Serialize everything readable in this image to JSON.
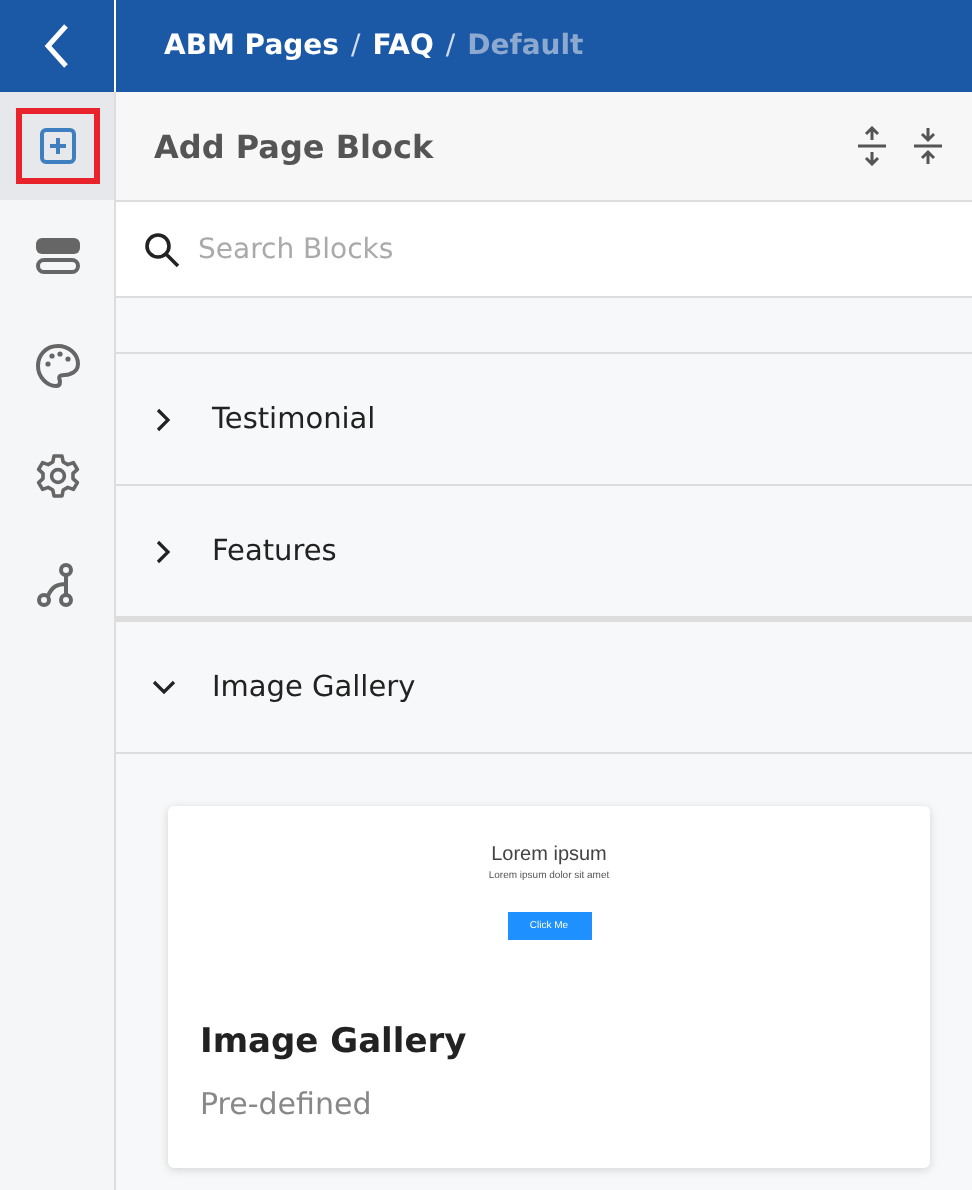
{
  "breadcrumb": [
    {
      "label": "ABM Pages",
      "current": false
    },
    {
      "label": "FAQ",
      "current": false
    },
    {
      "label": "Default",
      "current": true
    }
  ],
  "breadcrumb_separator": "/",
  "sidebar": {
    "items": [
      {
        "kind": "add",
        "selected": true
      },
      {
        "kind": "layout",
        "selected": false
      },
      {
        "kind": "palette",
        "selected": false
      },
      {
        "kind": "settings",
        "selected": false
      },
      {
        "kind": "flow",
        "selected": false
      }
    ]
  },
  "panel": {
    "title": "Add Page Block",
    "search": {
      "placeholder": "Search Blocks"
    }
  },
  "blocks": [
    {
      "label": "Testimonial",
      "expanded": false
    },
    {
      "label": "Features",
      "expanded": false
    },
    {
      "label": "Image Gallery",
      "expanded": true,
      "templates": [
        {
          "preview": {
            "heading": "Lorem ipsum",
            "text": "Lorem ipsum dolor sit amet",
            "button": "Click Me"
          },
          "title": "Image Gallery",
          "subtitle": "Pre-defined"
        }
      ]
    }
  ]
}
